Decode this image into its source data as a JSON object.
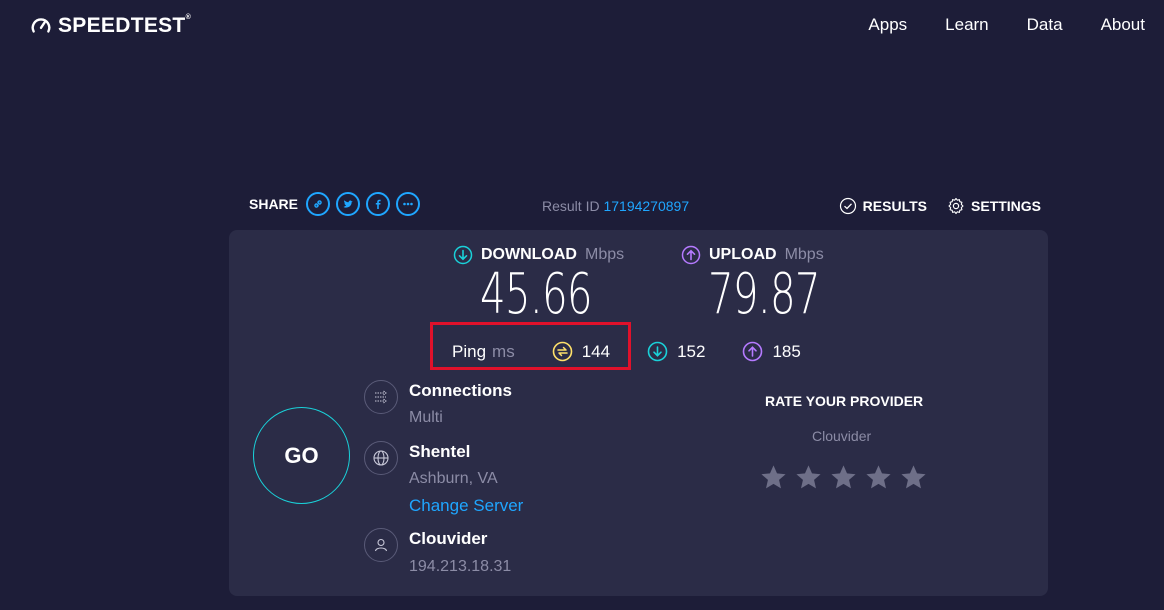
{
  "header": {
    "logo_text": "SPEEDTEST",
    "nav": [
      "Apps",
      "Learn",
      "Data",
      "About"
    ]
  },
  "share": {
    "label": "SHARE",
    "buttons": [
      "link-icon",
      "twitter-icon",
      "facebook-icon",
      "more-icon"
    ]
  },
  "result": {
    "label": "Result ID",
    "id": "17194270897"
  },
  "actions": {
    "results": "RESULTS",
    "settings": "SETTINGS"
  },
  "download": {
    "label": "DOWNLOAD",
    "unit": "Mbps",
    "value": "45.66"
  },
  "upload": {
    "label": "UPLOAD",
    "unit": "Mbps",
    "value": "79.87"
  },
  "ping": {
    "label": "Ping",
    "unit": "ms",
    "idle": "144",
    "download": "152",
    "upload": "185"
  },
  "go_label": "GO",
  "connections": {
    "title": "Connections",
    "value": "Multi"
  },
  "server": {
    "name": "Shentel",
    "location": "Ashburn, VA",
    "change_label": "Change Server"
  },
  "isp": {
    "name": "Clouvider",
    "ip": "194.213.18.31"
  },
  "rate": {
    "title": "RATE YOUR PROVIDER",
    "provider": "Clouvider",
    "stars": 5
  },
  "colors": {
    "background": "#1d1d38",
    "panel": "#2b2c47",
    "download_accent": "#1ad1d9",
    "upload_accent": "#b57aff",
    "ping_accent": "#ffe16a",
    "link": "#1fa6ff",
    "highlight": "#e0112b"
  }
}
